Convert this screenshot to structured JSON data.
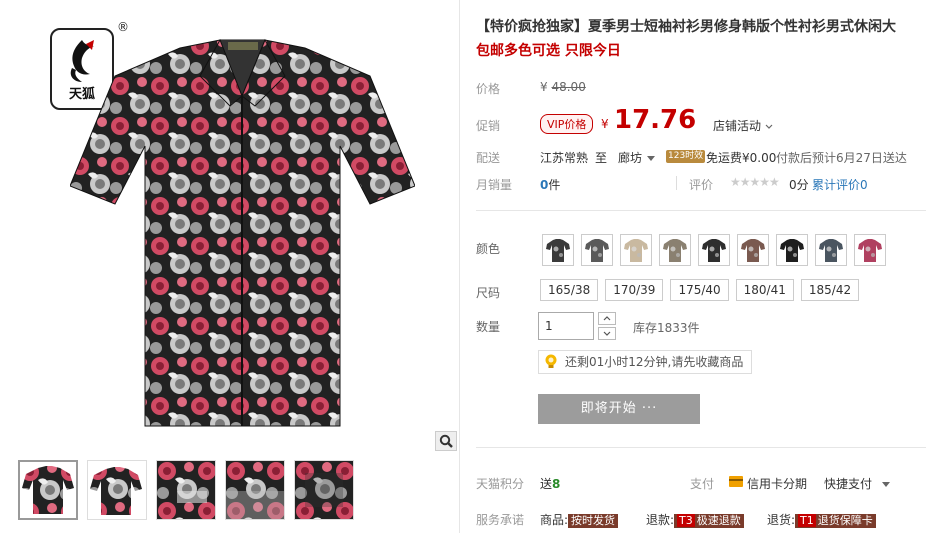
{
  "brand": {
    "logo_text": "天狐",
    "registered_mark": "®"
  },
  "gallery": {
    "thumbnails": [
      "thumb-1",
      "thumb-2",
      "thumb-3",
      "thumb-4",
      "thumb-5"
    ],
    "active_index": 0
  },
  "product": {
    "title": "【特价疯抢独家】夏季男士短袖衬衫男修身韩版个性衬衫男式休闲大",
    "subtitle": "包邮多色可选 只限今日"
  },
  "price": {
    "label": "价格",
    "currency": "¥",
    "original": "48.00"
  },
  "promo": {
    "label": "促销",
    "vip_tag": "VIP价格",
    "currency": "¥",
    "price": "17.76",
    "store_activity": "店铺活动"
  },
  "shipping": {
    "label": "配送",
    "from": "江苏常熟",
    "to_label": "至",
    "to": "廊坊",
    "badge": "123时效",
    "free_text": "免运费¥0.00",
    "estimate": "付款后预计6月27日送达"
  },
  "monthly": {
    "label": "月销量",
    "count": "0",
    "unit": "件",
    "rating_label": "评价",
    "stars": "★★★★★",
    "rating_value": "0分",
    "cumulative": "累计评价0"
  },
  "color": {
    "label": "颜色",
    "options": [
      "c1",
      "c2",
      "c3",
      "c4",
      "c5",
      "c6",
      "c7",
      "c8",
      "c9"
    ],
    "swatch_colors": [
      "#3a3a3a",
      "#5a5a5a",
      "#c9b9a0",
      "#8a8070",
      "#2e2e2e",
      "#7a5a50",
      "#1e1e1e",
      "#4a5560",
      "#b04060"
    ]
  },
  "size": {
    "label": "尺码",
    "options": [
      "165/38",
      "170/39",
      "175/40",
      "180/41",
      "185/42"
    ]
  },
  "quantity": {
    "label": "数量",
    "value": "1",
    "stock": "库存1833件"
  },
  "notice": {
    "text": "还剩01小时12分钟,请先收藏商品"
  },
  "actions": {
    "start_button": "即将开始 ···"
  },
  "points": {
    "label": "天猫积分",
    "prefix": "送",
    "value": "8",
    "pay_label": "支付",
    "card_text": "信用卡分期",
    "quick_pay": "快捷支付"
  },
  "promise": {
    "label": "服务承诺",
    "goods_label": "商品:",
    "goods_tag": "按时发货",
    "return_label": "退款:",
    "return_badge": "T3",
    "return_tag": "极速退款",
    "exchange_label": "退货:",
    "exchange_badge": "T1",
    "exchange_tag": "退货保障卡"
  },
  "colors": {
    "accent_red": "#c40000",
    "link_blue": "#2a77b8",
    "button_gray": "#9c9c9c"
  }
}
